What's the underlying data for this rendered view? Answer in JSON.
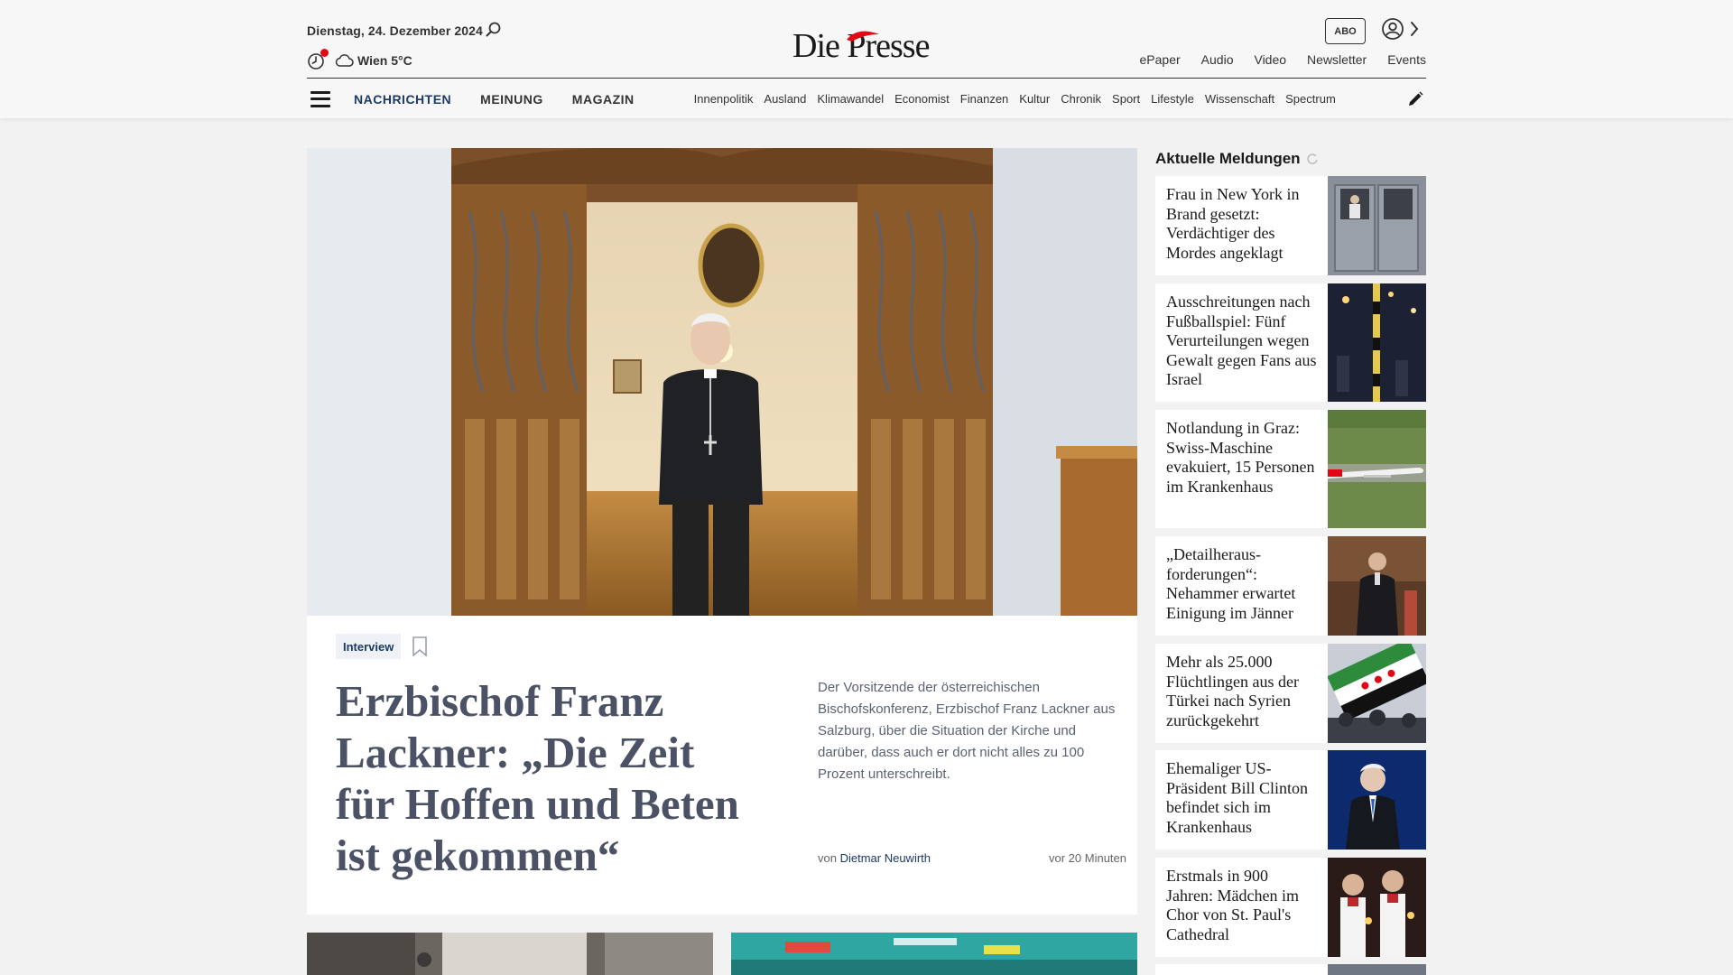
{
  "header": {
    "date": "Dienstag, 24. Dezember 2024",
    "weather": "Wien 5°C",
    "logo": "Die Presse",
    "abo_label": "ABO",
    "links": [
      "ePaper",
      "Audio",
      "Video",
      "Newsletter",
      "Events"
    ],
    "main_nav": [
      {
        "label": "NACHRICHTEN",
        "color": "#1c3a63"
      },
      {
        "label": "MEINUNG",
        "color": "#333333"
      },
      {
        "label": "MAGAZIN",
        "color": "#333333"
      }
    ],
    "sub_nav": [
      "Innenpolitik",
      "Ausland",
      "Klimawandel",
      "Economist",
      "Finanzen",
      "Kultur",
      "Chronik",
      "Sport",
      "Lifestyle",
      "Wissenschaft",
      "Spectrum"
    ]
  },
  "hero": {
    "tag": "Interview",
    "title": "Erzbischof Franz Lackner: „Die Zeit für Hoffen und Beten ist gekommen“",
    "teaser": "Der Vorsitzende der österreichischen Bischofskonferenz, Erzbischof Franz Lackner aus Salzburg, über die Situation der Kirche und darüber, dass auch er dort nicht alles zu 100 Prozent unterschreibt.",
    "author_prefix": "von",
    "author": "Dietmar Neuwirth",
    "time": "vor 20 Minuten"
  },
  "sidebar": {
    "title": "Aktuelle Meldungen",
    "items": [
      {
        "title": "Frau in New York in Brand gesetzt: Verdächtiger des Mordes angeklagt"
      },
      {
        "title": "Ausschreitungen nach Fußballspiel: Fünf Verurteilungen wegen Gewalt gegen Fans aus Israel"
      },
      {
        "title": "Notlandung in Graz: Swiss-Maschine evakuiert, 15 Personen im Krankenhaus"
      },
      {
        "title": "„Detailheraus-forderungen“: Nehammer erwartet Einigung im Jänner"
      },
      {
        "title": "Mehr als 25.000 Flüchtlingen aus der Türkei nach Syrien zurückgekehrt"
      },
      {
        "title": "Ehemaliger US-Präsident Bill Clinton befindet sich im Krankenhaus"
      },
      {
        "title": "Erstmals in 900 Jahren: Mädchen im Chor von St. Paul's Cathedral"
      }
    ]
  },
  "colors": {
    "accent": "#1c3a63",
    "logo_red": "#e30613",
    "headline_gray": "#4b5265"
  },
  "icons": {
    "search": "search-icon",
    "clock": "clock-icon",
    "weather": "cloud-icon",
    "user": "user-icon",
    "menu": "menu-icon",
    "edit": "pencil-icon",
    "bookmark": "bookmark-icon"
  }
}
